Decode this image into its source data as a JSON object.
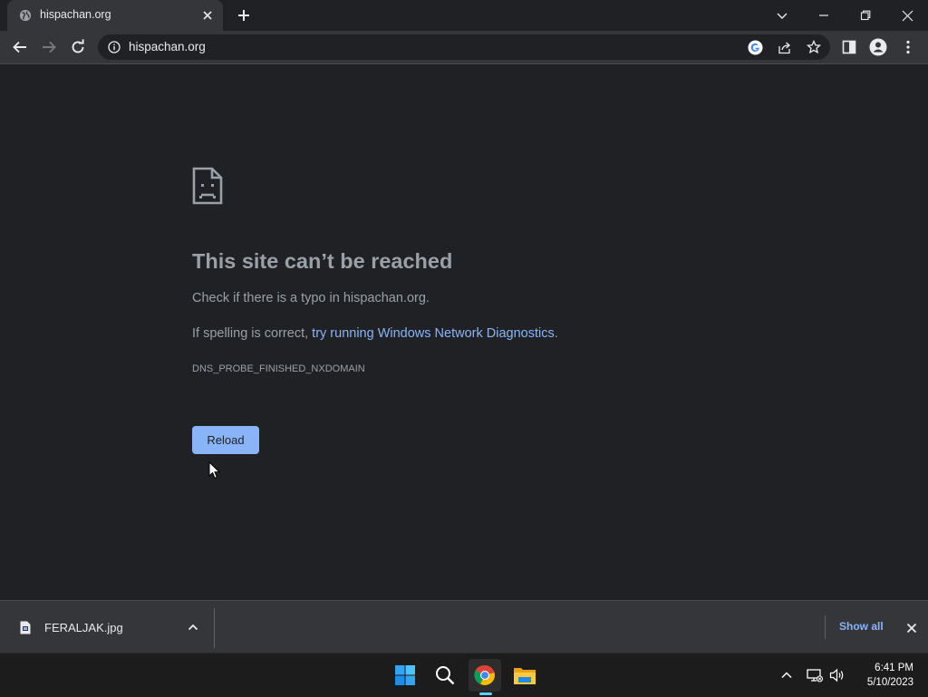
{
  "browser": {
    "tab": {
      "title": "hispachan.org"
    },
    "address_bar": {
      "url": "hispachan.org"
    }
  },
  "error_page": {
    "title": "This site can’t be reached",
    "line1": "Check if there is a typo in hispachan.org.",
    "line2_prefix": "If spelling is correct, ",
    "line2_link": "try running Windows Network Diagnostics",
    "line2_suffix": ".",
    "error_code": "DNS_PROBE_FINISHED_NXDOMAIN",
    "reload_label": "Reload"
  },
  "download_bar": {
    "file_name": "FERALJAK.jpg",
    "show_all_label": "Show all"
  },
  "taskbar": {
    "time": "6:41 PM",
    "date": "5/10/2023"
  },
  "colors": {
    "page_bg": "#202124",
    "toolbar_bg": "#35363a",
    "link": "#8ab4f8",
    "button_bg": "#8ab4f8",
    "text_muted": "#9aa0a6"
  },
  "icons": [
    "globe-icon",
    "close-icon",
    "plus-icon",
    "chevron-down-icon",
    "minimize-icon",
    "restore-icon",
    "back-icon",
    "forward-icon",
    "refresh-icon",
    "info-icon",
    "google-lens-icon",
    "share-icon",
    "star-icon",
    "side-panel-icon",
    "profile-icon",
    "more-vert-icon",
    "sad-file-icon",
    "file-icon",
    "chevron-up-icon",
    "windows-start-icon",
    "search-icon",
    "chrome-icon",
    "file-explorer-icon",
    "network-icon",
    "volume-icon",
    "cursor-icon"
  ]
}
